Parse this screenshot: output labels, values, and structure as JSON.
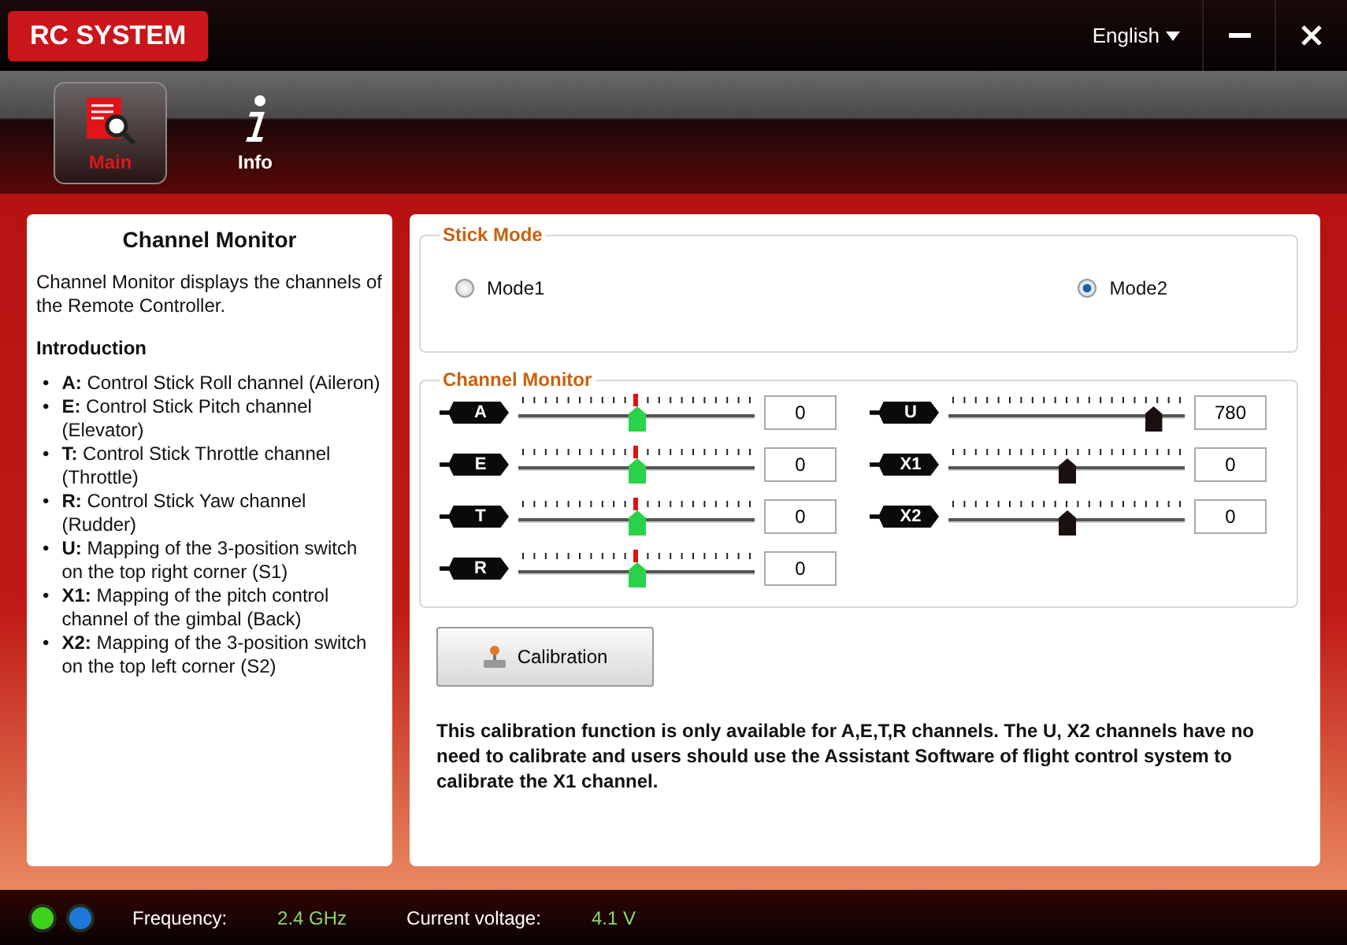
{
  "window": {
    "title": "RC SYSTEM",
    "language": "English"
  },
  "tabs": [
    {
      "label": "Main",
      "selected": true
    },
    {
      "label": "Info",
      "selected": false
    }
  ],
  "help": {
    "title": "Channel Monitor",
    "description": "Channel Monitor displays the channels of the Remote Controller.",
    "heading": "Introduction",
    "bullet": "•",
    "items": [
      "**A:** Control Stick Roll channel (Aileron)",
      "**E:** Control Stick Pitch channel (Elevator)",
      "**T:** Control Stick Throttle channel (Throttle)",
      "**R:** Control Stick Yaw channel (Rudder)",
      "**U:** Mapping of the 3-position switch on the top right corner (S1)",
      "**X1:** Mapping of the pitch control channel of the gimbal (Back)",
      "**X2:** Mapping of the 3-position switch on the top left corner (S2)"
    ]
  },
  "stick_mode": {
    "title": "Stick Mode",
    "options": [
      {
        "label": "Mode1",
        "selected": false
      },
      {
        "label": "Mode2",
        "selected": true
      }
    ]
  },
  "channel_monitor": {
    "title": "Channel Monitor",
    "channels": [
      {
        "name": "A",
        "kind": "stick",
        "level": 0.5,
        "value": "0"
      },
      {
        "name": "U",
        "kind": "switch",
        "level": 0.88,
        "value": "780"
      },
      {
        "name": "E",
        "kind": "stick",
        "level": 0.5,
        "value": "0"
      },
      {
        "name": "X1",
        "kind": "switch",
        "level": 0.5,
        "value": "0"
      },
      {
        "name": "T",
        "kind": "stick",
        "level": 0.5,
        "value": "0"
      },
      {
        "name": "X2",
        "kind": "switch",
        "level": 0.5,
        "value": "0"
      },
      {
        "name": "R",
        "kind": "stick",
        "level": 0.5,
        "value": "0"
      }
    ]
  },
  "calibration_button": "Calibration",
  "note": "This calibration function is only available for A,E,T,R channels. The U, X2 channels have no need to calibrate and users should use the Assistant Software of flight control system to calibrate the X1 channel.",
  "status_bar": {
    "leds": [
      {
        "color": "#3fd21c"
      },
      {
        "color": "#1f78d8"
      }
    ],
    "fields": [
      {
        "label": "Frequency:",
        "value": "2.4 GHz"
      },
      {
        "label": "Current voltage:",
        "value": "4.1 V"
      }
    ]
  }
}
